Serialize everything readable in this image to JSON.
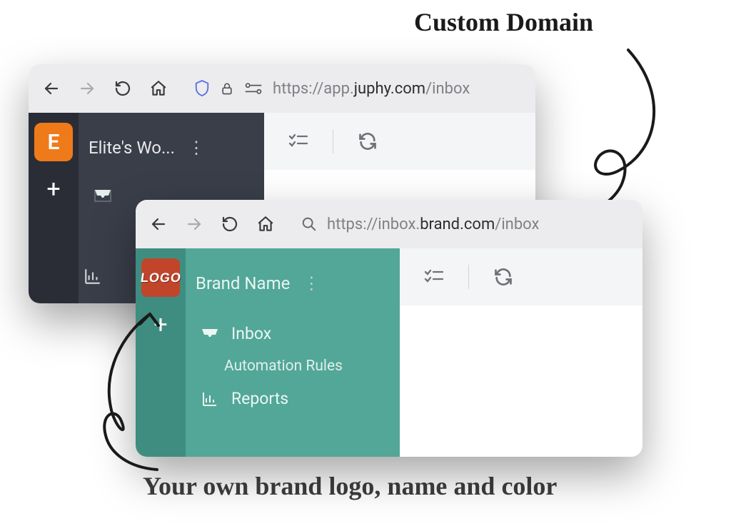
{
  "annotations": {
    "top": "Custom Domain",
    "bottom": "Your own brand logo, name and color"
  },
  "windowA": {
    "url_plain": "https://app.",
    "url_bold": "juphy.com",
    "url_tail": "/inbox",
    "workspace_badge": "E",
    "workspace_name": "Elite's Wo..."
  },
  "windowB": {
    "url_plain": "https://inbox.",
    "url_bold": "brand.com",
    "url_tail": "/inbox",
    "logo_text": "LOGO",
    "workspace_name": "Brand Name",
    "nav": {
      "inbox": "Inbox",
      "automation": "Automation Rules",
      "reports": "Reports"
    }
  }
}
